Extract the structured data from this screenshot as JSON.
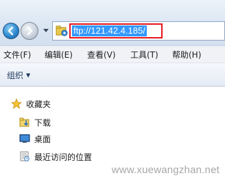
{
  "address_bar": {
    "url": "ftp://121.42.4.185/"
  },
  "menu": {
    "items": [
      {
        "label": "文件(F)"
      },
      {
        "label": "编辑(E)"
      },
      {
        "label": "查看(V)"
      },
      {
        "label": "工具(T)"
      },
      {
        "label": "帮助(H)"
      }
    ]
  },
  "command_bar": {
    "organize_label": "组织"
  },
  "nav_pane": {
    "favorites_label": "收藏夹",
    "items": [
      {
        "label": "下载",
        "icon": "download-folder-icon"
      },
      {
        "label": "桌面",
        "icon": "desktop-icon"
      },
      {
        "label": "最近访问的位置",
        "icon": "recent-places-icon"
      }
    ]
  },
  "watermark": "www.xuewangzhan.net",
  "colors": {
    "highlight_border": "#e8141c",
    "selection": "#3399ff"
  }
}
